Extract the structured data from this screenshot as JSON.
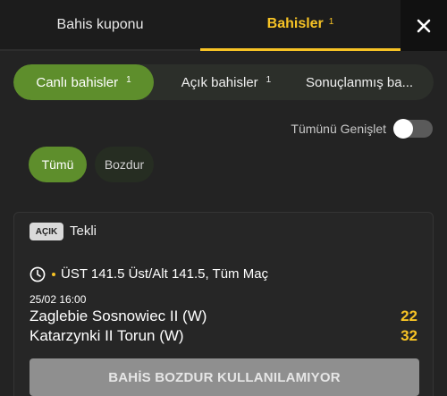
{
  "header": {
    "tabs": [
      {
        "label": "Bahis kuponu",
        "badge": ""
      },
      {
        "label": "Bahisler",
        "badge": "1"
      }
    ],
    "close_icon": "close-icon"
  },
  "bets_tabs": [
    {
      "label": "Canlı bahisler",
      "badge": "1"
    },
    {
      "label": "Açık bahisler",
      "badge": "1"
    },
    {
      "label": "Sonuçlanmış ba..."
    }
  ],
  "expand": {
    "label": "Tümünü Genişlet",
    "enabled": false
  },
  "filters": [
    {
      "label": "Tümü",
      "active": true
    },
    {
      "label": "Bozdur",
      "active": false
    }
  ],
  "bet": {
    "status": "AÇIK",
    "type": "Tekli",
    "market": "ÜST 141.5 Üst/Alt 141.5, Tüm Maç",
    "datetime": "25/02 16:00",
    "home_team": "Zaglebie Sosnowiec II (W)",
    "away_team": "Katarzynki II Torun (W)",
    "home_score": "22",
    "away_score": "32",
    "cashout_label": "BAHİS BOZDUR KULLANILAMIYOR"
  },
  "colors": {
    "accent": "#f7c325",
    "active_green": "#5e8e2c",
    "background": "#232323"
  }
}
